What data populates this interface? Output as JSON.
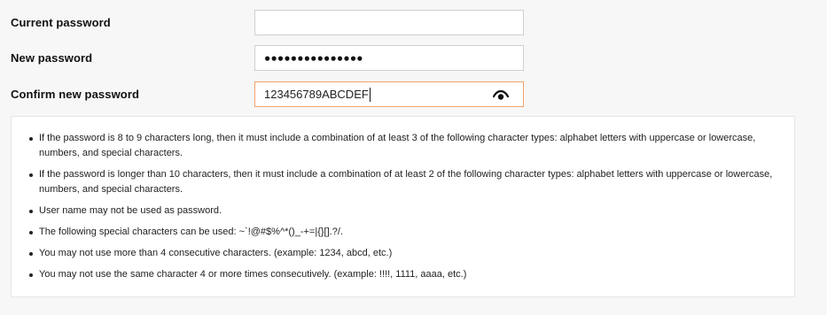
{
  "form": {
    "current_password": {
      "label": "Current password",
      "value": ""
    },
    "new_password": {
      "label": "New password",
      "masked_value": "●●●●●●●●●●●●●●●"
    },
    "confirm_new_password": {
      "label": "Confirm new password",
      "value": "123456789ABCDEF"
    },
    "eye_icon": "eye-icon"
  },
  "rules": [
    "If the password is 8 to 9 characters long, then it must include a combination of at least 3 of the following character types: alphabet letters with uppercase or lowercase, numbers, and special characters.",
    "If the password is longer than 10 characters, then it must include a combination of at least 2 of the following character types: alphabet letters with uppercase or lowercase, numbers, and special characters.",
    "User name may not be used as password.",
    "The following special characters can be used: ~`!@#$%^*()_-+=|{}[].?/.",
    "You may not use more than 4 consecutive characters. (example: 1234, abcd, etc.)",
    "You may not use the same character 4 or more times consecutively. (example: !!!!, 1111, aaaa, etc.)"
  ],
  "colors": {
    "background": "#f7f7f7",
    "panel_background": "#ffffff",
    "focus_border": "#f3a26c",
    "input_border": "#cfcfcf"
  }
}
